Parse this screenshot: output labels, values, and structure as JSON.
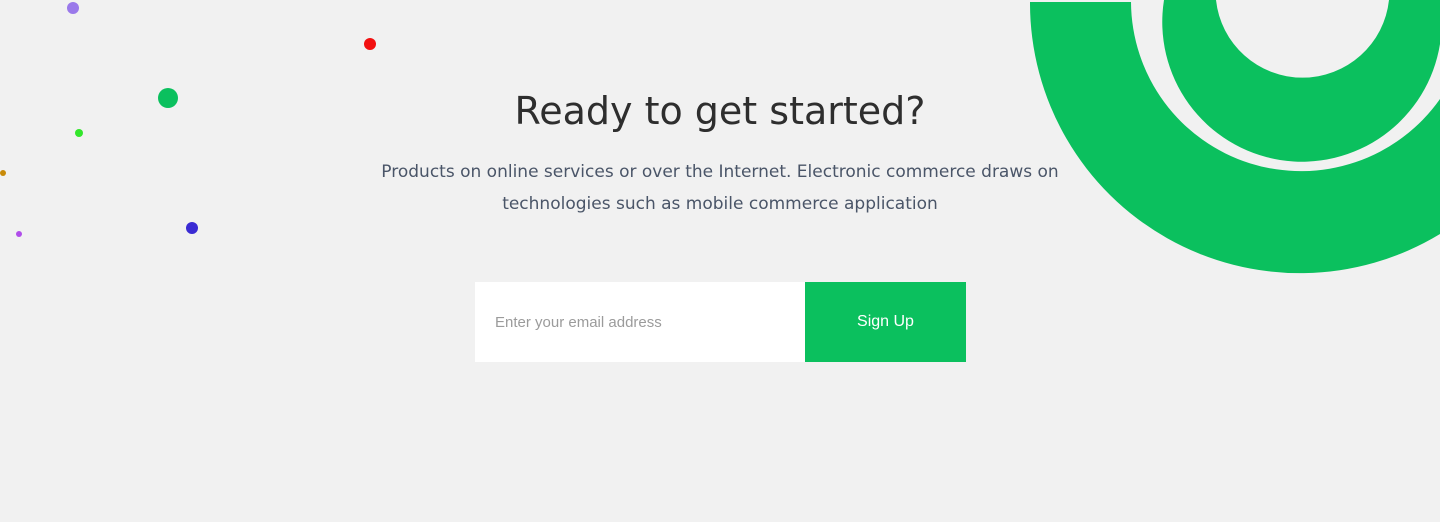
{
  "cta": {
    "title": "Ready to get started?",
    "description": "Products on online services or over the Internet. Electronic commerce draws on technologies such as mobile  commerce application",
    "email_placeholder": "Enter your email address",
    "signup_label": "Sign Up"
  },
  "colors": {
    "background": "#f1f1f1",
    "accent": "#0bc05e",
    "heading": "#2e2e2e",
    "body_text": "#4a5568"
  },
  "decorative_dots": [
    {
      "color": "#9a79ea"
    },
    {
      "color": "#f21010"
    },
    {
      "color": "#0bc05e"
    },
    {
      "color": "#33e62b"
    },
    {
      "color": "#c88a08"
    },
    {
      "color": "#b04dea"
    },
    {
      "color": "#3a2bd3"
    }
  ]
}
